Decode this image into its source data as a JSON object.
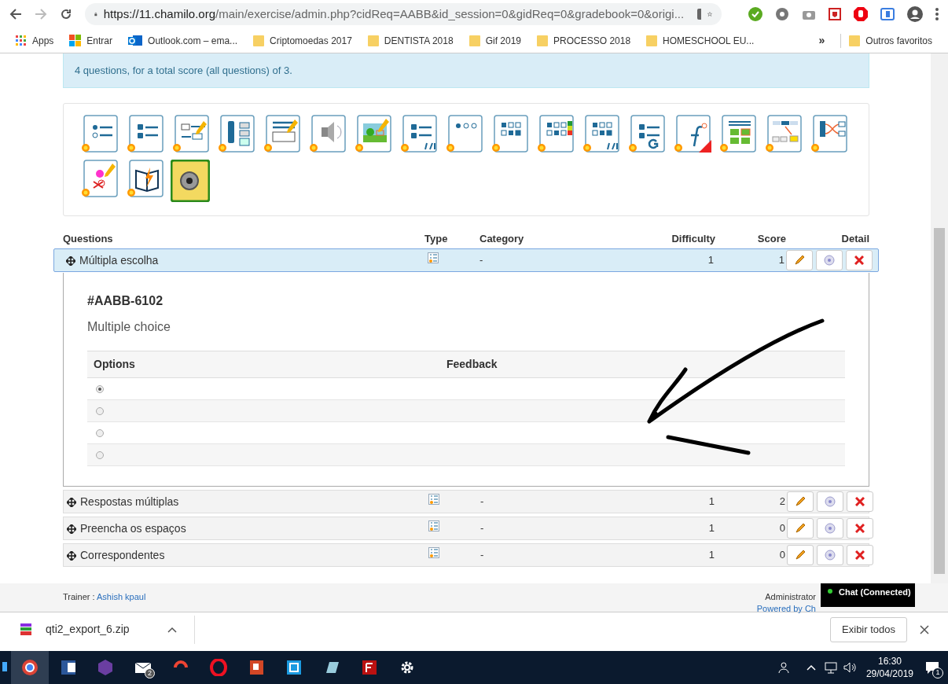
{
  "browser": {
    "url_host": "https://11.chamilo.org",
    "url_path": "/main/exercise/admin.php?cidReq=AABB&id_session=0&gidReq=0&gradebook=0&origi...",
    "bookmarks": [
      "Apps",
      "Entrar",
      "Outlook.com – ema...",
      "Criptomoedas 2017",
      "DENTISTA 2018",
      "Gif 2019",
      "PROCESSO 2018",
      "HOMESCHOOL EU..."
    ],
    "overflow": "»",
    "other_bookmarks": "Outros favoritos"
  },
  "info": "4 questions, for a total score (all questions) of 3.",
  "table": {
    "columns": [
      "Questions",
      "Type",
      "Category",
      "Difficulty",
      "Score",
      "Detail"
    ],
    "rows": [
      {
        "name": "Múltipla escolha",
        "category": "-",
        "difficulty": "1",
        "score": "1",
        "expanded": true
      },
      {
        "name": "Respostas múltiplas",
        "category": "-",
        "difficulty": "1",
        "score": "2",
        "expanded": false
      },
      {
        "name": "Preencha os espaços",
        "category": "-",
        "difficulty": "1",
        "score": "0",
        "expanded": false
      },
      {
        "name": "Correspondentes",
        "category": "-",
        "difficulty": "1",
        "score": "0",
        "expanded": false
      }
    ]
  },
  "detail": {
    "code": "#AABB-6102",
    "type": "Multiple choice",
    "columns": [
      "Options",
      "Feedback"
    ],
    "options": [
      {
        "selected": true
      },
      {
        "selected": false
      },
      {
        "selected": false
      },
      {
        "selected": false
      }
    ]
  },
  "footer": {
    "trainer_label": "Trainer : ",
    "trainer": "Ashish kpaul",
    "admin": "Administrator",
    "powered": "Powered by Ch",
    "chat": "Chat (Connected)"
  },
  "download": {
    "file": "qti2_export_6.zip",
    "show_all": "Exibir todos"
  },
  "taskbar": {
    "mail_badge": "2",
    "time": "16:30",
    "date": "29/04/2019",
    "notif": "1"
  }
}
